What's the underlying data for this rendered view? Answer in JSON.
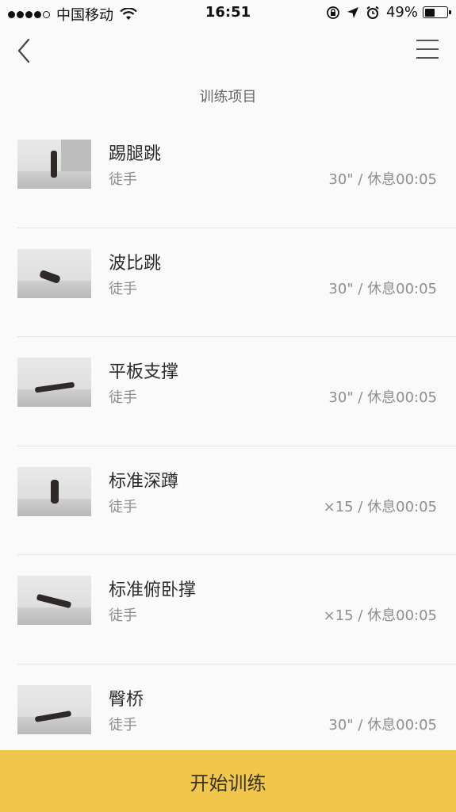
{
  "status_bar": {
    "carrier": "中国移动",
    "time": "16:51",
    "battery_percent": "49%",
    "battery_level": 0.49,
    "signal_bars_filled": 4,
    "signal_bars_total": 5
  },
  "nav": {
    "back_icon": "chevron-left-icon",
    "menu_icon": "menu-icon",
    "title": "训练项目"
  },
  "exercises": [
    {
      "name": "踢腿跳",
      "equipment": "徒手",
      "detail": "30\" / 休息00:05"
    },
    {
      "name": "波比跳",
      "equipment": "徒手",
      "detail": "30\" / 休息00:05"
    },
    {
      "name": "平板支撑",
      "equipment": "徒手",
      "detail": "30\" / 休息00:05"
    },
    {
      "name": "标准深蹲",
      "equipment": "徒手",
      "detail": "×15 / 休息00:05"
    },
    {
      "name": "标准俯卧撑",
      "equipment": "徒手",
      "detail": "×15 / 休息00:05"
    },
    {
      "name": "臀桥",
      "equipment": "徒手",
      "detail": "30\" / 休息00:05"
    }
  ],
  "start_button": {
    "label": "开始训练"
  },
  "colors": {
    "accent": "#f0c74a",
    "background": "#fbfafa",
    "muted_text": "#8e8e8e",
    "divider": "#e6e6e6"
  }
}
